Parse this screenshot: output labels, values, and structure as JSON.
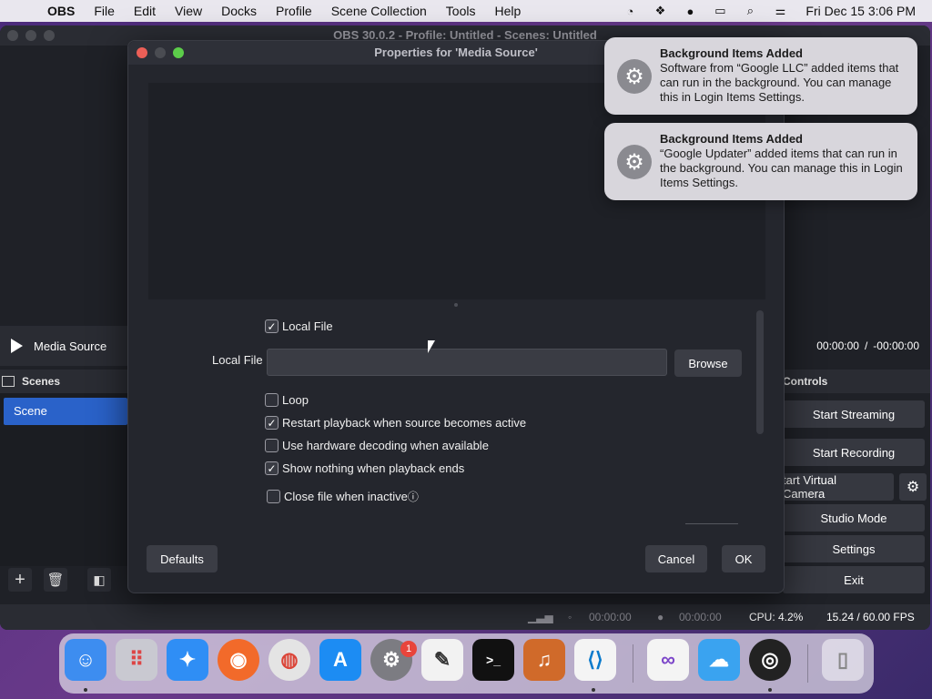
{
  "menubar": {
    "app_name": "OBS",
    "items": [
      "File",
      "Edit",
      "View",
      "Docks",
      "Profile",
      "Scene Collection",
      "Tools",
      "Help"
    ],
    "clock": "Fri Dec 15  3:06 PM"
  },
  "obs": {
    "title": "OBS 30.0.2 - Profile: Untitled - Scenes: Untitled",
    "source_name": "Media Source",
    "scenes_header": "Scenes",
    "scene_item": "Scene",
    "time_current": "00:00:00",
    "time_separator": "/",
    "time_remaining": "-00:00:00",
    "controls_header": "Controls",
    "buttons": {
      "start_streaming": "Start Streaming",
      "start_recording": "Start Recording",
      "virtual_camera": "tart Virtual Camera",
      "studio_mode": "Studio Mode",
      "settings": "Settings",
      "exit": "Exit"
    },
    "status": {
      "stream_time": "00:00:00",
      "rec_time": "00:00:00",
      "cpu": "CPU: 4.2%",
      "fps": "15.24 / 60.00 FPS"
    }
  },
  "dialog": {
    "title": "Properties for 'Media Source'",
    "local_file_checkbox": "Local File",
    "local_file_label": "Local File",
    "local_file_value": "",
    "browse": "Browse",
    "options": [
      {
        "label": "Loop",
        "checked": false
      },
      {
        "label": "Restart playback when source becomes active",
        "checked": true
      },
      {
        "label": "Use hardware decoding when available",
        "checked": false
      },
      {
        "label": "Show nothing when playback ends",
        "checked": true
      },
      {
        "label": "Close file when inactive",
        "checked": false
      }
    ],
    "defaults": "Defaults",
    "cancel": "Cancel",
    "ok": "OK"
  },
  "notifications": [
    {
      "title": "Background Items Added",
      "body": "Software from “Google LLC” added items that can run in the background. You can manage this in Login Items Settings."
    },
    {
      "title": "Background Items Added",
      "body": "“Google Updater” added items that can run in the background. You can manage this in Login Items Settings."
    }
  ],
  "dock": {
    "badge_count": "1",
    "apps": [
      "finder",
      "launchpad",
      "safari",
      "firefox",
      "chrome",
      "app-store",
      "system-settings",
      "textedit",
      "terminal",
      "garageband",
      "vscode",
      "visual-studio",
      "weather",
      "obs",
      "trash"
    ]
  }
}
